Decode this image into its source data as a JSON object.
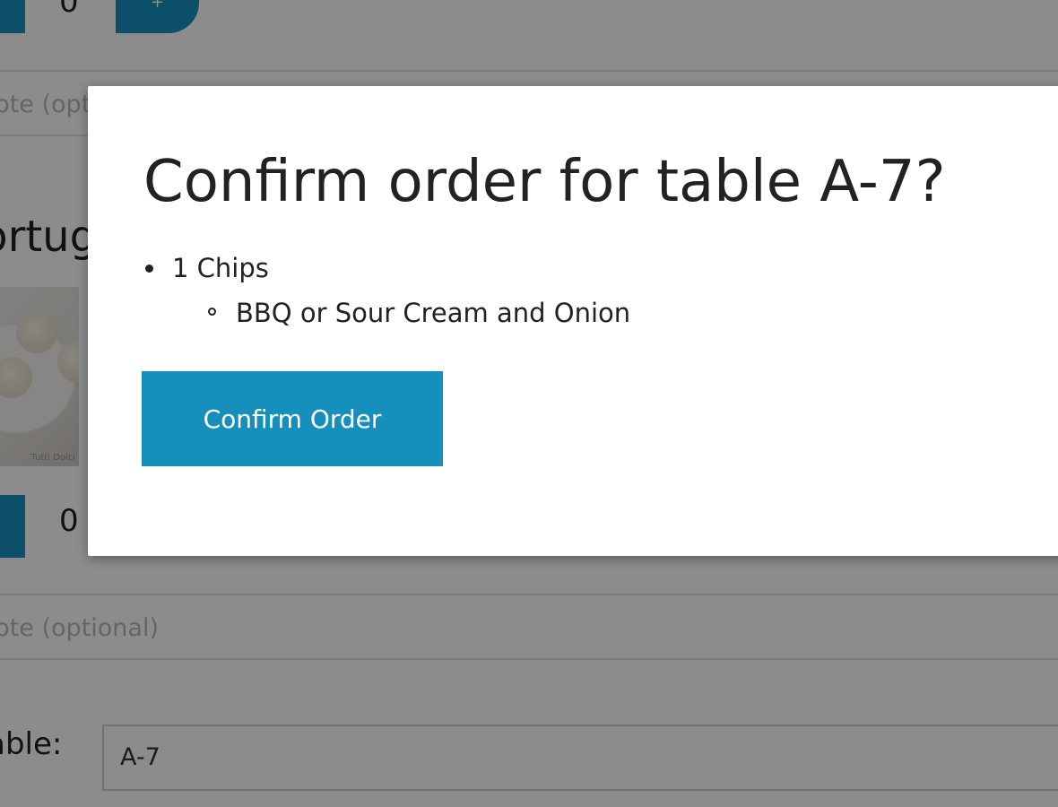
{
  "background": {
    "top_qty_value": "0",
    "top_plus_label": "+",
    "note_placeholder_1": "Note (optional)",
    "item_name": "Portuguese",
    "image_watermark": "Tutti Dolci",
    "bottom_qty_value": "0",
    "note_placeholder_2": "Note (optional)",
    "table_label": "Table:",
    "table_value": "A-7"
  },
  "modal": {
    "title": "Confirm order for table A-7?",
    "items": [
      {
        "label": "1 Chips",
        "options": [
          "BBQ or Sour Cream and Onion"
        ]
      }
    ],
    "confirm_label": "Confirm Order"
  },
  "colors": {
    "accent": "#1590bd",
    "overlay": "#000000"
  }
}
